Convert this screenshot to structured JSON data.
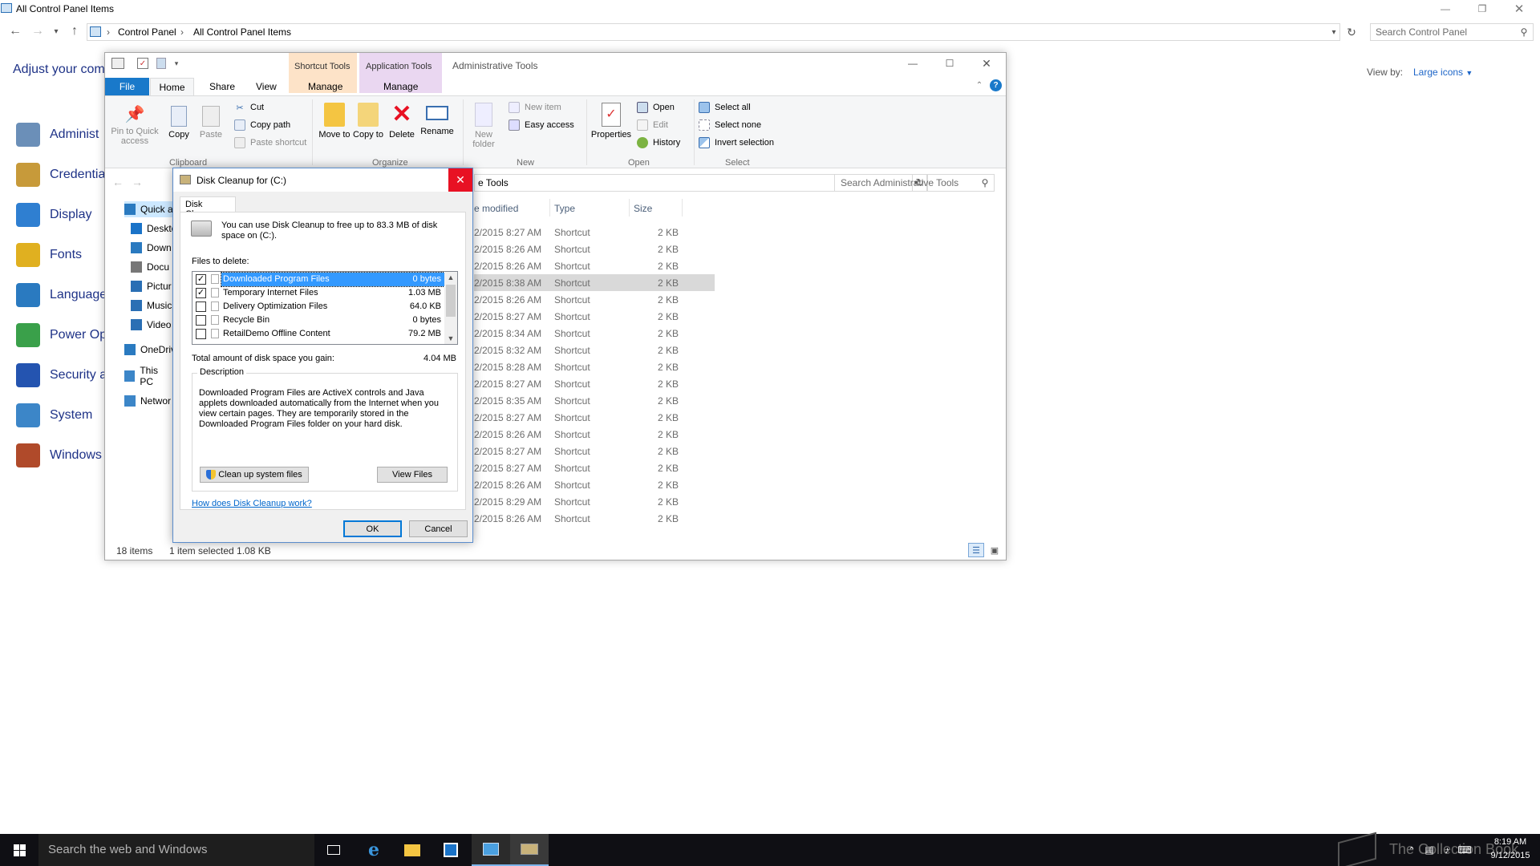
{
  "control_panel": {
    "window_title": "All Control Panel Items",
    "breadcrumb": [
      "Control Panel",
      "All Control Panel Items"
    ],
    "search_placeholder": "Search Control Panel",
    "heading": "Adjust your com",
    "view_by_label": "View by:",
    "view_by_value": "Large icons",
    "items": [
      {
        "label": "Administ",
        "icon": "admin-tools-icon",
        "color": "#6b8fb8"
      },
      {
        "label": "Credential",
        "icon": "credential-icon",
        "color": "#c79a3a"
      },
      {
        "label": "Display",
        "icon": "display-icon",
        "color": "#2f7fd1"
      },
      {
        "label": "Fonts",
        "icon": "fonts-icon",
        "color": "#e0b020"
      },
      {
        "label": "Language",
        "icon": "language-icon",
        "color": "#2a7ac0"
      },
      {
        "label": "Power Op",
        "icon": "power-icon",
        "color": "#3aa04a"
      },
      {
        "label": "Security a",
        "icon": "security-flag-icon",
        "color": "#2454b0"
      },
      {
        "label": "System",
        "icon": "system-icon",
        "color": "#3c86c8"
      },
      {
        "label": "Windows",
        "icon": "windows-icon",
        "color": "#b04a2a"
      }
    ]
  },
  "explorer": {
    "ribbon_context_tabs": [
      "Shortcut Tools",
      "Application Tools"
    ],
    "window_title": "Administrative Tools",
    "tabs": [
      "File",
      "Home",
      "Share",
      "View",
      "Manage",
      "Manage"
    ],
    "clipboard": {
      "pin": "Pin to Quick access",
      "copy": "Copy",
      "paste": "Paste",
      "cut": "Cut",
      "copy_path": "Copy path",
      "paste_shortcut": "Paste shortcut",
      "group": "Clipboard"
    },
    "organize": {
      "move_to": "Move to",
      "copy_to": "Copy to",
      "delete": "Delete",
      "rename": "Rename",
      "group": "Organize"
    },
    "new": {
      "new_folder": "New folder",
      "new_item": "New item",
      "easy_access": "Easy access",
      "group": "New"
    },
    "open": {
      "properties": "Properties",
      "open": "Open",
      "edit": "Edit",
      "history": "History",
      "group": "Open"
    },
    "select": {
      "select_all": "Select all",
      "select_none": "Select none",
      "invert": "Invert selection",
      "group": "Select"
    },
    "address_fragment": "e Tools",
    "search_placeholder": "Search Administrative Tools",
    "nav": [
      "Quick a",
      "Deskto",
      "Down",
      "Docu",
      "Pictur",
      "Music",
      "Video",
      "OneDriv",
      "This PC",
      "Networ"
    ],
    "columns": {
      "modified": "e modified",
      "type": "Type",
      "size": "Size"
    },
    "rows": [
      {
        "date": "2/2015 8:27 AM",
        "type": "Shortcut",
        "size": "2 KB"
      },
      {
        "date": "2/2015 8:26 AM",
        "type": "Shortcut",
        "size": "2 KB"
      },
      {
        "date": "2/2015 8:26 AM",
        "type": "Shortcut",
        "size": "2 KB"
      },
      {
        "date": "2/2015 8:38 AM",
        "type": "Shortcut",
        "size": "2 KB"
      },
      {
        "date": "2/2015 8:26 AM",
        "type": "Shortcut",
        "size": "2 KB"
      },
      {
        "date": "2/2015 8:27 AM",
        "type": "Shortcut",
        "size": "2 KB"
      },
      {
        "date": "2/2015 8:34 AM",
        "type": "Shortcut",
        "size": "2 KB"
      },
      {
        "date": "2/2015 8:32 AM",
        "type": "Shortcut",
        "size": "2 KB"
      },
      {
        "date": "2/2015 8:28 AM",
        "type": "Shortcut",
        "size": "2 KB"
      },
      {
        "date": "2/2015 8:27 AM",
        "type": "Shortcut",
        "size": "2 KB"
      },
      {
        "date": "2/2015 8:35 AM",
        "type": "Shortcut",
        "size": "2 KB"
      },
      {
        "date": "2/2015 8:27 AM",
        "type": "Shortcut",
        "size": "2 KB"
      },
      {
        "date": "2/2015 8:26 AM",
        "type": "Shortcut",
        "size": "2 KB"
      },
      {
        "date": "2/2015 8:27 AM",
        "type": "Shortcut",
        "size": "2 KB"
      },
      {
        "date": "2/2015 8:27 AM",
        "type": "Shortcut",
        "size": "2 KB"
      },
      {
        "date": "2/2015 8:26 AM",
        "type": "Shortcut",
        "size": "2 KB"
      },
      {
        "date": "2/2015 8:29 AM",
        "type": "Shortcut",
        "size": "2 KB"
      },
      {
        "date": "2/2015 8:26 AM",
        "type": "Shortcut",
        "size": "2 KB"
      }
    ],
    "selected_row": 3,
    "status_items": "18 items",
    "status_selected": "1 item selected  1.08 KB"
  },
  "dialog": {
    "title": "Disk Cleanup for  (C:)",
    "tab": "Disk Cleanup",
    "intro": "You can use Disk Cleanup to free up to 83.3 MB of disk space on  (C:).",
    "files_label": "Files to delete:",
    "files": [
      {
        "name": "Downloaded Program Files",
        "size": "0 bytes",
        "checked": true,
        "selected": true
      },
      {
        "name": "Temporary Internet Files",
        "size": "1.03 MB",
        "checked": true,
        "selected": false
      },
      {
        "name": "Delivery Optimization Files",
        "size": "64.0 KB",
        "checked": false,
        "selected": false
      },
      {
        "name": "Recycle Bin",
        "size": "0 bytes",
        "checked": false,
        "selected": false
      },
      {
        "name": "RetailDemo Offline Content",
        "size": "79.2 MB",
        "checked": false,
        "selected": false
      }
    ],
    "total_label": "Total amount of disk space you gain:",
    "total_value": "4.04 MB",
    "description_label": "Description",
    "description": "Downloaded Program Files are ActiveX controls and Java applets downloaded automatically from the Internet when you view certain pages. They are temporarily stored in the Downloaded Program Files folder on your hard disk.",
    "cleanup_system": "Clean up system files",
    "view_files": "View Files",
    "help_link": "How does Disk Cleanup work?",
    "ok": "OK",
    "cancel": "Cancel"
  },
  "taskbar": {
    "search_placeholder": "Search the web and Windows",
    "time": "8:19 AM",
    "date": "9/12/2015",
    "watermark": "The Collection Book"
  }
}
